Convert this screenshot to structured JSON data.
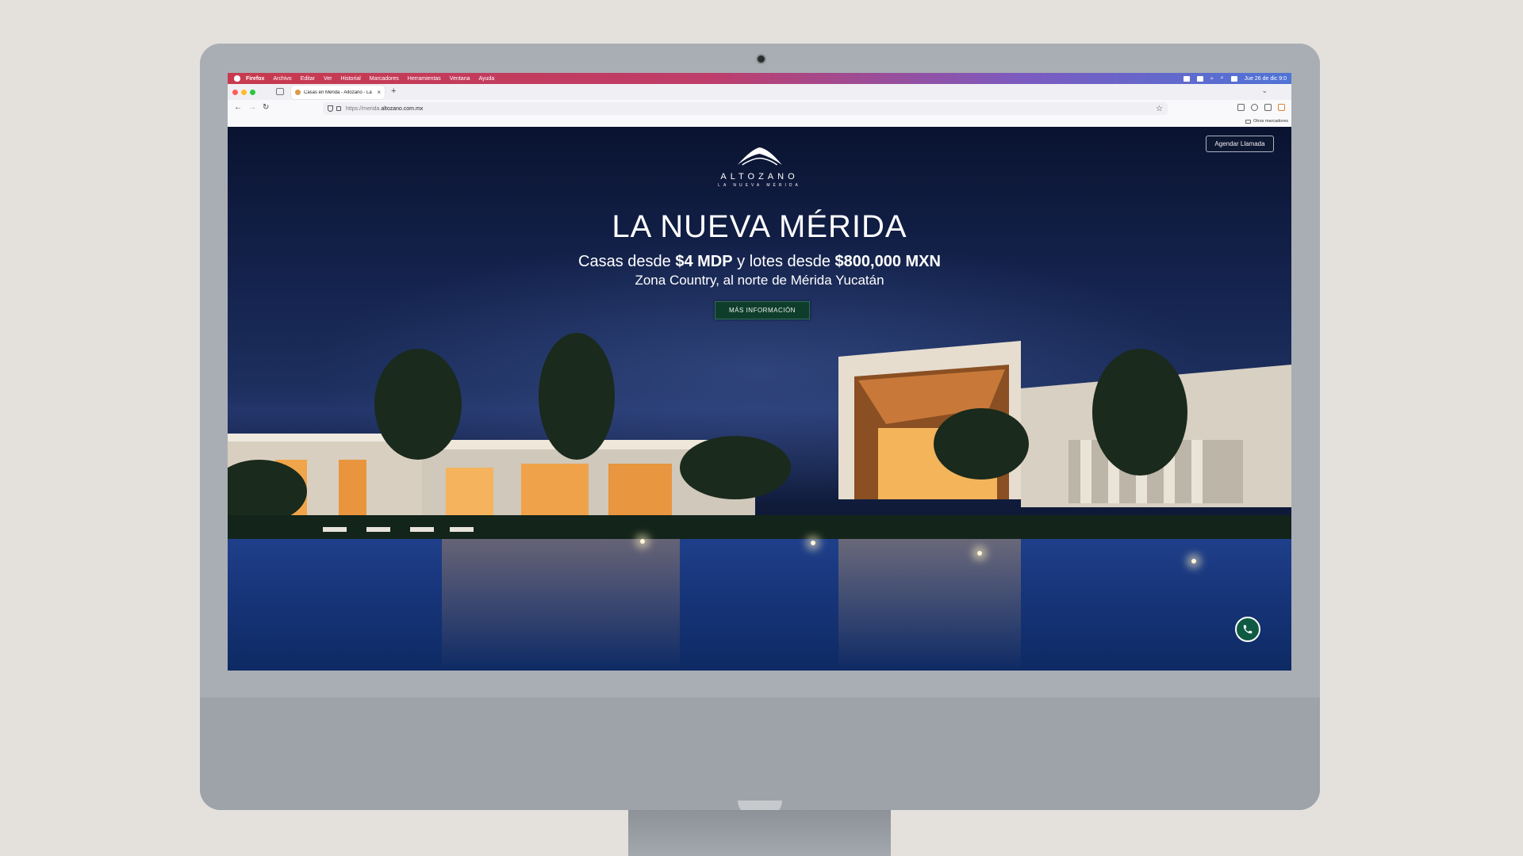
{
  "menubar": {
    "app": "Firefox",
    "items": [
      "Archivo",
      "Editar",
      "Ver",
      "Historial",
      "Marcadores",
      "Herramientas",
      "Ventana",
      "Ayuda"
    ],
    "clock": "Jue 26 de dic  9:0"
  },
  "browser": {
    "tab_title": "Casas en Mérida - Altozano - La",
    "url_prefix": "https://merida.",
    "url_domain": "altozano.com.mx",
    "bookmarks_folder": "Otros marcadores"
  },
  "page": {
    "logo_brand": "ALTOZANO",
    "logo_sub": "LA NUEVA MÉRIDA",
    "schedule_call": "Agendar Llamada",
    "title": "LA NUEVA MÉRIDA",
    "line1_a": "Casas desde ",
    "line1_b": "$4 MDP",
    "line1_c": " y lotes desde ",
    "line1_d": "$800,000 MXN",
    "line2": "Zona Country, al norte de Mérida Yucatán",
    "cta": "MÁS INFORMACIÓN"
  },
  "colors": {
    "cta_green": "#0f3d2c",
    "phone_green": "#0f5a43",
    "night_sky": "#15244f",
    "pool": "#1f3f8a"
  }
}
